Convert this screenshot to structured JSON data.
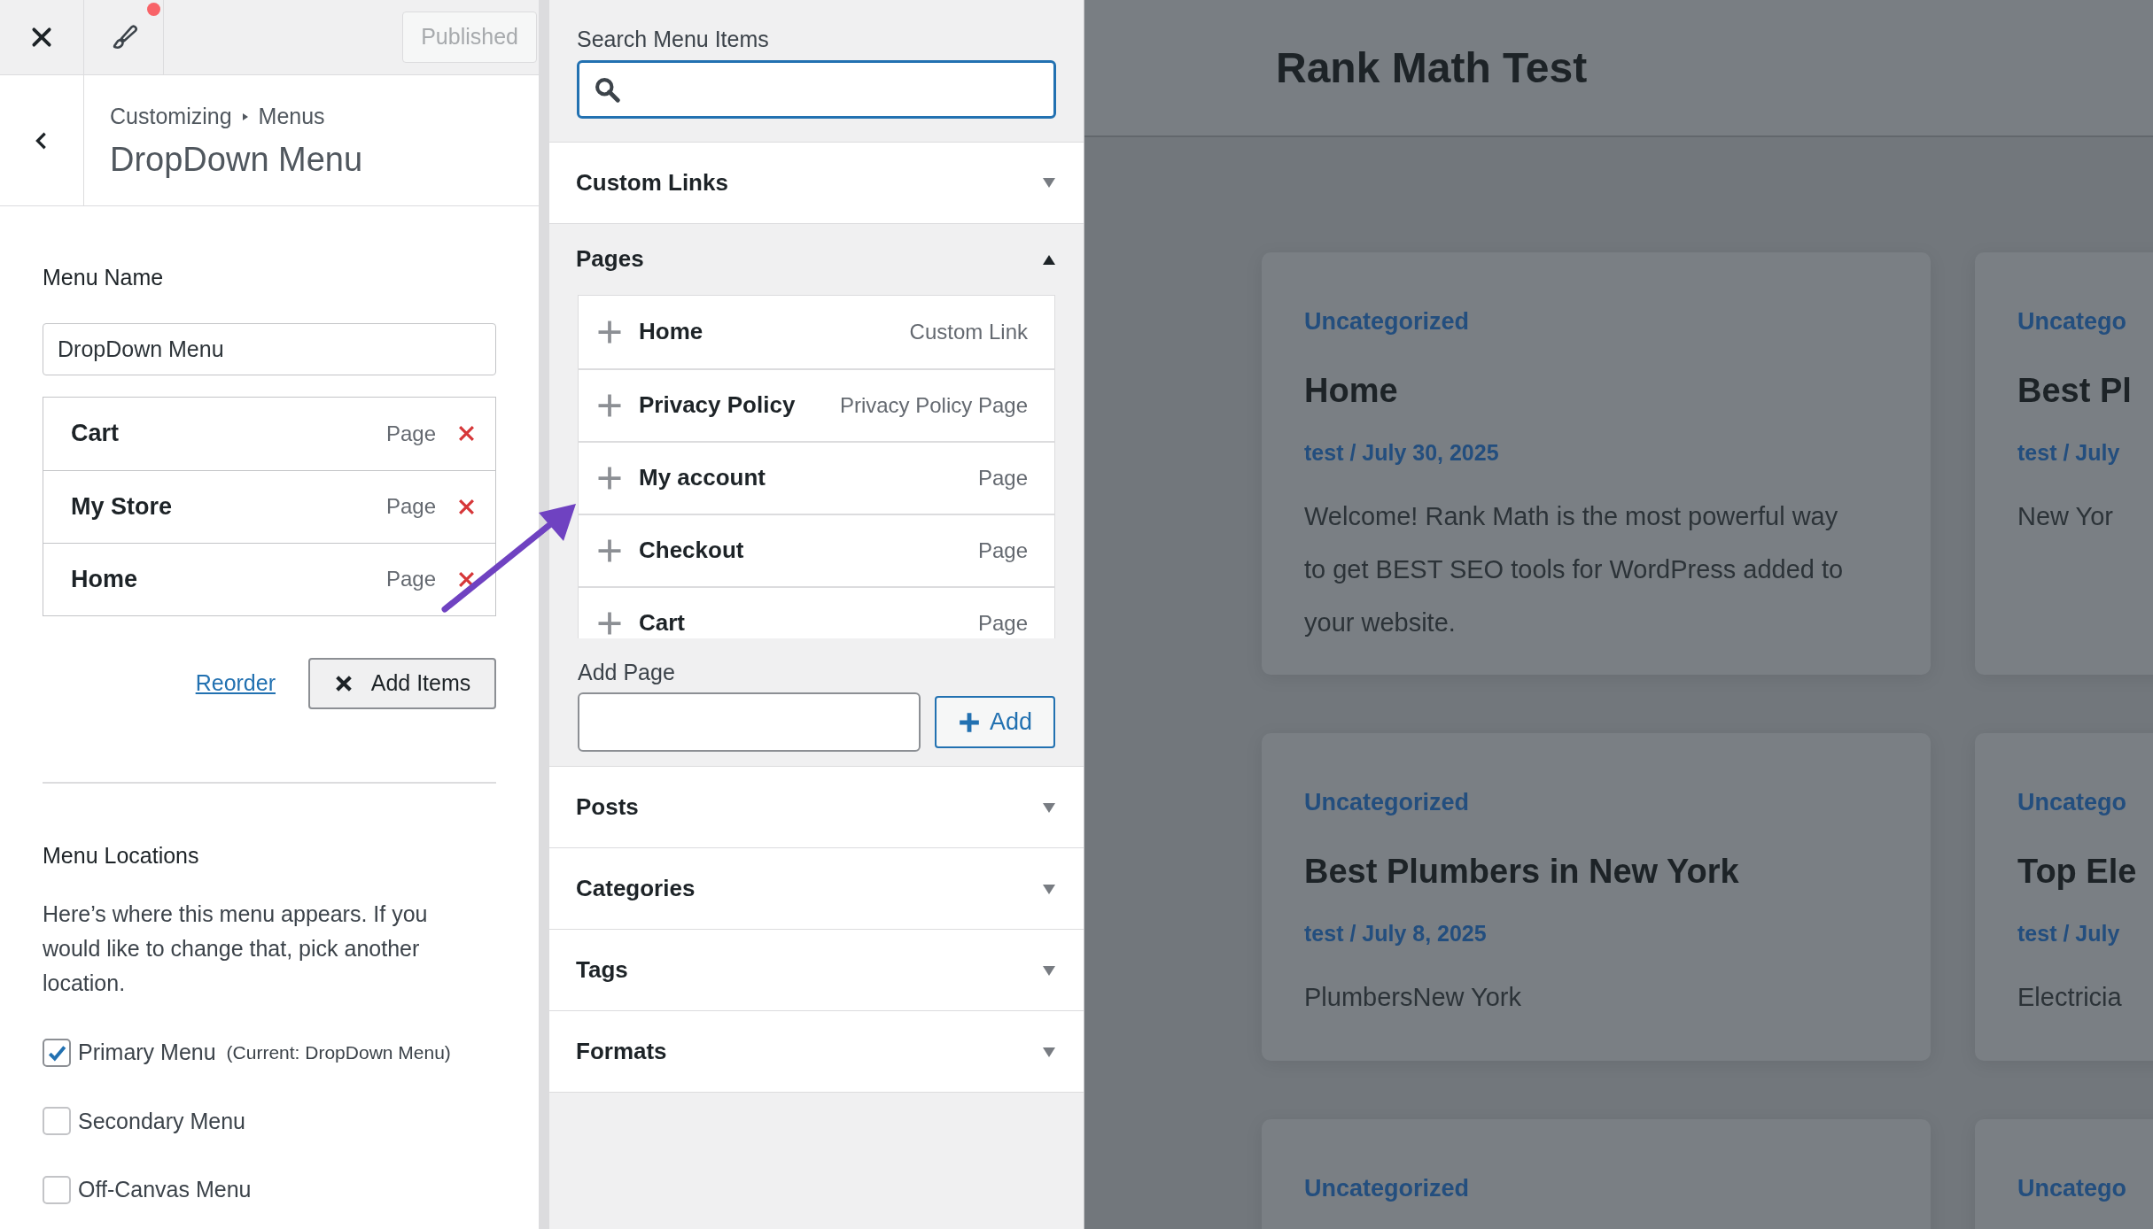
{
  "topbar": {
    "published_button": "Published",
    "unsaved_changes": true
  },
  "header": {
    "breadcrumb": [
      "Customizing",
      "Menus"
    ],
    "title": "DropDown Menu"
  },
  "menu_name": {
    "label": "Menu Name",
    "value": "DropDown Menu"
  },
  "menu_items": [
    {
      "title": "Cart",
      "type": "Page"
    },
    {
      "title": "My Store",
      "type": "Page"
    },
    {
      "title": "Home",
      "type": "Page"
    }
  ],
  "reorder_link": "Reorder",
  "add_items_button": "Add Items",
  "menu_locations": {
    "title": "Menu Locations",
    "description": "Here’s where this menu appears. If you would like to change that, pick another location.",
    "locations": [
      {
        "label": "Primary Menu",
        "note": "(Current: DropDown Menu)",
        "checked": true
      },
      {
        "label": "Secondary Menu",
        "checked": false
      },
      {
        "label": "Off-Canvas Menu",
        "checked": false
      }
    ]
  },
  "search": {
    "label": "Search Menu Items"
  },
  "sections": [
    {
      "title": "Custom Links",
      "expanded": false
    },
    {
      "title": "Pages",
      "expanded": true,
      "items": [
        {
          "title": "Home",
          "type": "Custom Link"
        },
        {
          "title": "Privacy Policy",
          "type": "Privacy Policy Page"
        },
        {
          "title": "My account",
          "type": "Page"
        },
        {
          "title": "Checkout",
          "type": "Page"
        },
        {
          "title": "Cart",
          "type": "Page"
        }
      ],
      "add_label": "Add Page",
      "add_button": "Add"
    },
    {
      "title": "Posts",
      "expanded": false
    },
    {
      "title": "Categories",
      "expanded": false
    },
    {
      "title": "Tags",
      "expanded": false
    },
    {
      "title": "Formats",
      "expanded": false
    }
  ],
  "preview": {
    "site_title": "Rank Math Test",
    "cards": [
      {
        "category": "Uncategorized",
        "title": "Home",
        "meta": "test / July 30, 2025",
        "excerpt": "Welcome! Rank Math is the most powerful way to get BEST SEO tools for WordPress added to your website."
      },
      {
        "category": "Uncatego",
        "title": "Best Pl",
        "meta": "test / July",
        "excerpt": "New Yor"
      },
      {
        "category": "Uncategorized",
        "title": "Best Plumbers in New York",
        "meta": "test / July 8, 2025",
        "excerpt": "PlumbersNew York"
      },
      {
        "category": "Uncatego",
        "title": "Top Ele",
        "meta": "test / July",
        "excerpt": "Electricia"
      },
      {
        "category": "Uncategorized"
      },
      {
        "category": "Uncatego"
      }
    ]
  }
}
